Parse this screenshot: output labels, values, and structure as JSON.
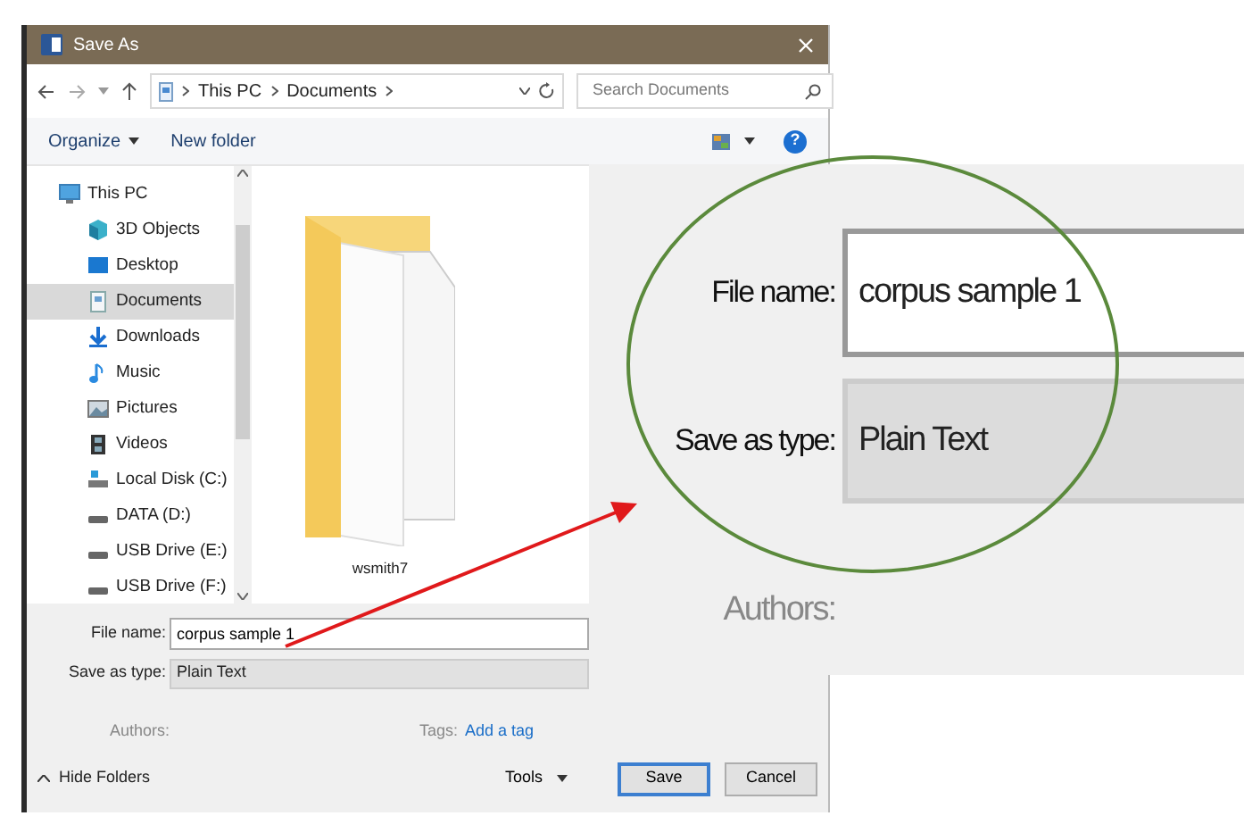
{
  "window": {
    "title": "Save As"
  },
  "address_bar": {
    "path": [
      "This PC",
      "Documents"
    ]
  },
  "search": {
    "placeholder": "Search Documents"
  },
  "toolbar": {
    "organize": "Organize",
    "new_folder": "New folder",
    "help": "?"
  },
  "navigation": [
    {
      "label": "This PC",
      "selected": false,
      "children": [
        {
          "label": "3D Objects",
          "selected": false
        },
        {
          "label": "Desktop",
          "selected": false
        },
        {
          "label": "Documents",
          "selected": true
        },
        {
          "label": "Downloads",
          "selected": false
        },
        {
          "label": "Music",
          "selected": false
        },
        {
          "label": "Pictures",
          "selected": false
        },
        {
          "label": "Videos",
          "selected": false
        },
        {
          "label": "Local Disk (C:)",
          "selected": false
        },
        {
          "label": "DATA (D:)",
          "selected": false
        },
        {
          "label": "USB Drive (E:)",
          "selected": false
        },
        {
          "label": "USB Drive (F:)",
          "selected": false
        }
      ]
    }
  ],
  "files": [
    {
      "name": "wsmith7"
    }
  ],
  "form": {
    "file_name": {
      "label": "File name:",
      "value": "corpus sample 1"
    },
    "save_as_type": {
      "label": "Save as type:",
      "value": "Plain Text"
    },
    "authors": {
      "label": "Authors:"
    },
    "tags": {
      "label": "Tags:",
      "link": "Add a tag"
    }
  },
  "footer": {
    "hide_folders": "Hide Folders",
    "tools": "Tools",
    "buttons": [
      {
        "label": "Save",
        "default": true
      },
      {
        "label": "Cancel",
        "default": false
      }
    ]
  },
  "callout": {
    "file_name": {
      "label": "File name:",
      "value": "corpus sample 1"
    },
    "save_as_type": {
      "label": "Save as type:",
      "value": "Plain Text"
    },
    "authors": {
      "label": "Authors:"
    }
  }
}
